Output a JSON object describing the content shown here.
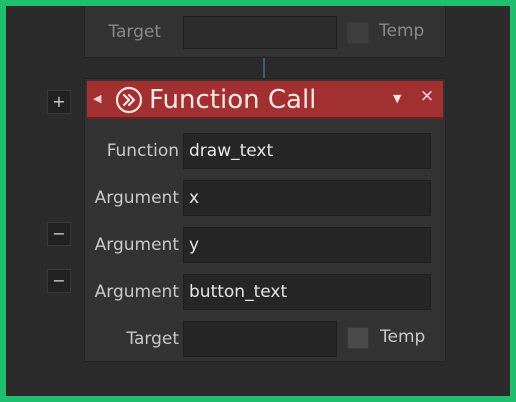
{
  "prev_node": {
    "target_label": "Target",
    "target_value": "",
    "temp_label": "Temp"
  },
  "side_buttons": [
    "+",
    "−",
    "−"
  ],
  "node": {
    "title": "Function Call",
    "rows": [
      {
        "label": "Function",
        "value": "draw_text"
      },
      {
        "label": "Argument",
        "value": "x"
      },
      {
        "label": "Argument",
        "value": "y"
      },
      {
        "label": "Argument",
        "value": "button_text"
      }
    ],
    "target_label": "Target",
    "target_value": "",
    "temp_label": "Temp",
    "collapse_glyph": "◀",
    "menu_glyph": "▼",
    "close_glyph": "×"
  },
  "colors": {
    "frame": "#1fbf6e",
    "canvas": "#2b2b2b",
    "node_body": "#333333",
    "header": "#a33030",
    "field": "#262626"
  },
  "icons": {
    "header_icon": "fast-forward-circle-icon"
  }
}
